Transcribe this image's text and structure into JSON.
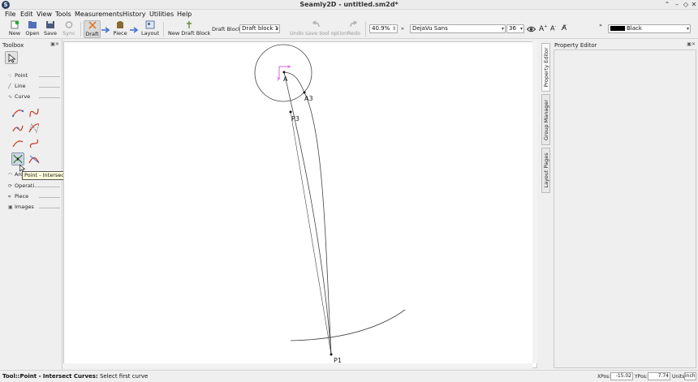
{
  "window": {
    "title": "Seamly2D - untitled.sm2d*",
    "app_icon_glyph": "S"
  },
  "menu": [
    "File",
    "Edit",
    "View",
    "Tools",
    "Measurements",
    "History",
    "Utilities",
    "Help"
  ],
  "toolbar": {
    "new": "New",
    "open": "Open",
    "save": "Save",
    "sync": "Sync",
    "draft": "Draft",
    "piece": "Piece",
    "layout": "Layout",
    "new_draft_block": "New Draft Block",
    "draft_block_label": "Draft Block:",
    "draft_block_value": "Draft block 1",
    "undo": "Undo save tool option",
    "redo": "Redo",
    "zoom": "40.9%",
    "font": "DejaVu Sans",
    "font_size": "36",
    "color": "Black",
    "overflow": "»"
  },
  "toolbox": {
    "title": "Toolbox",
    "groups": {
      "point": "Point",
      "line": "Line",
      "curve": "Curve",
      "arc": "Arc",
      "operations": "Operati...",
      "piece": "Piece",
      "images": "Images"
    }
  },
  "tooltip": "Point - Intersect Curves (I, C)",
  "canvas": {
    "labels": {
      "A": "A",
      "A3": "A3",
      "P3": "P3",
      "P1": "P1"
    }
  },
  "side_tabs": {
    "property_editor": "Property Editor",
    "group_manager": "Group Manager",
    "layout_pages": "Layout Pages"
  },
  "property_editor": {
    "title": "Property Editor"
  },
  "status": {
    "tool": "Tool::Point - Intersect Curves:",
    "message": "Select first curve",
    "xpos_label": "XPos:",
    "xpos": "-15.02",
    "ypos_label": "YPos:",
    "ypos": "7.74",
    "units_label": "Units:",
    "units": "inch"
  },
  "colors": {
    "accent": "#3b6fd1",
    "canvas_bg": "#ffffff",
    "origin_marker": "#d63ad6"
  }
}
